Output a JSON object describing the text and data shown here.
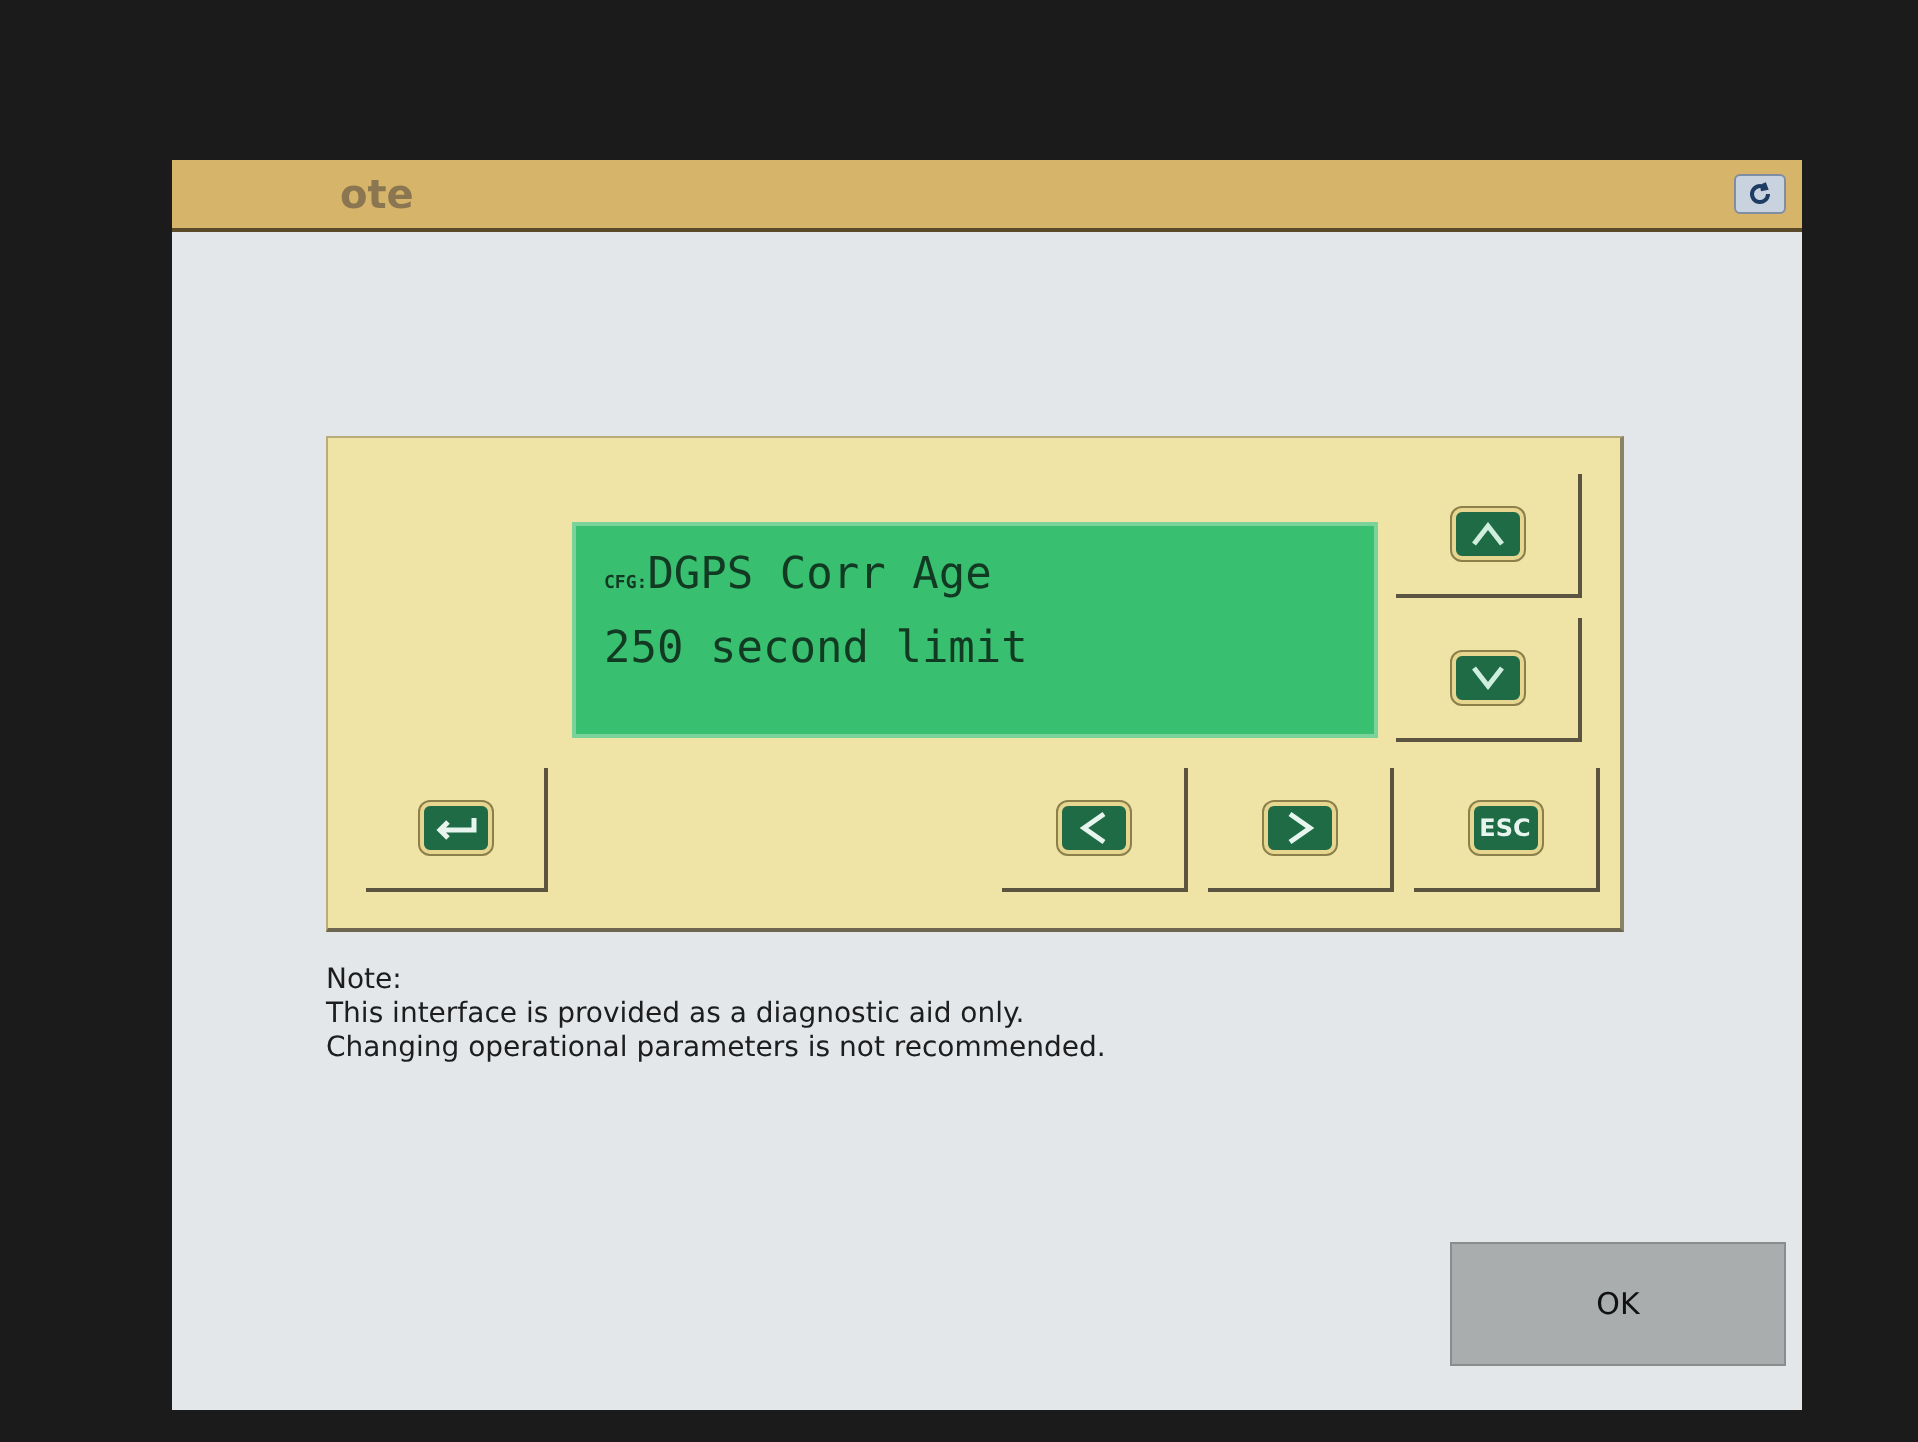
{
  "window": {
    "title": "ote"
  },
  "lcd": {
    "lines": [
      {
        "prefix": "CFG:",
        "text": "DGPS Corr Age"
      },
      {
        "text": "250 second limit"
      }
    ]
  },
  "side_keys": [
    {
      "kind": "up"
    },
    {
      "kind": "down"
    }
  ],
  "bottom_keys": [
    {
      "kind": "left"
    },
    {
      "kind": "right"
    },
    {
      "kind": "esc",
      "label": "ESC"
    }
  ],
  "enter_key": {
    "kind": "enter"
  },
  "note": {
    "heading": "Note:",
    "lines": [
      "This interface is provided as a diagnostic aid only.",
      "Changing operational parameters is not recommended."
    ]
  },
  "buttons": [
    {
      "label": "OK"
    }
  ]
}
